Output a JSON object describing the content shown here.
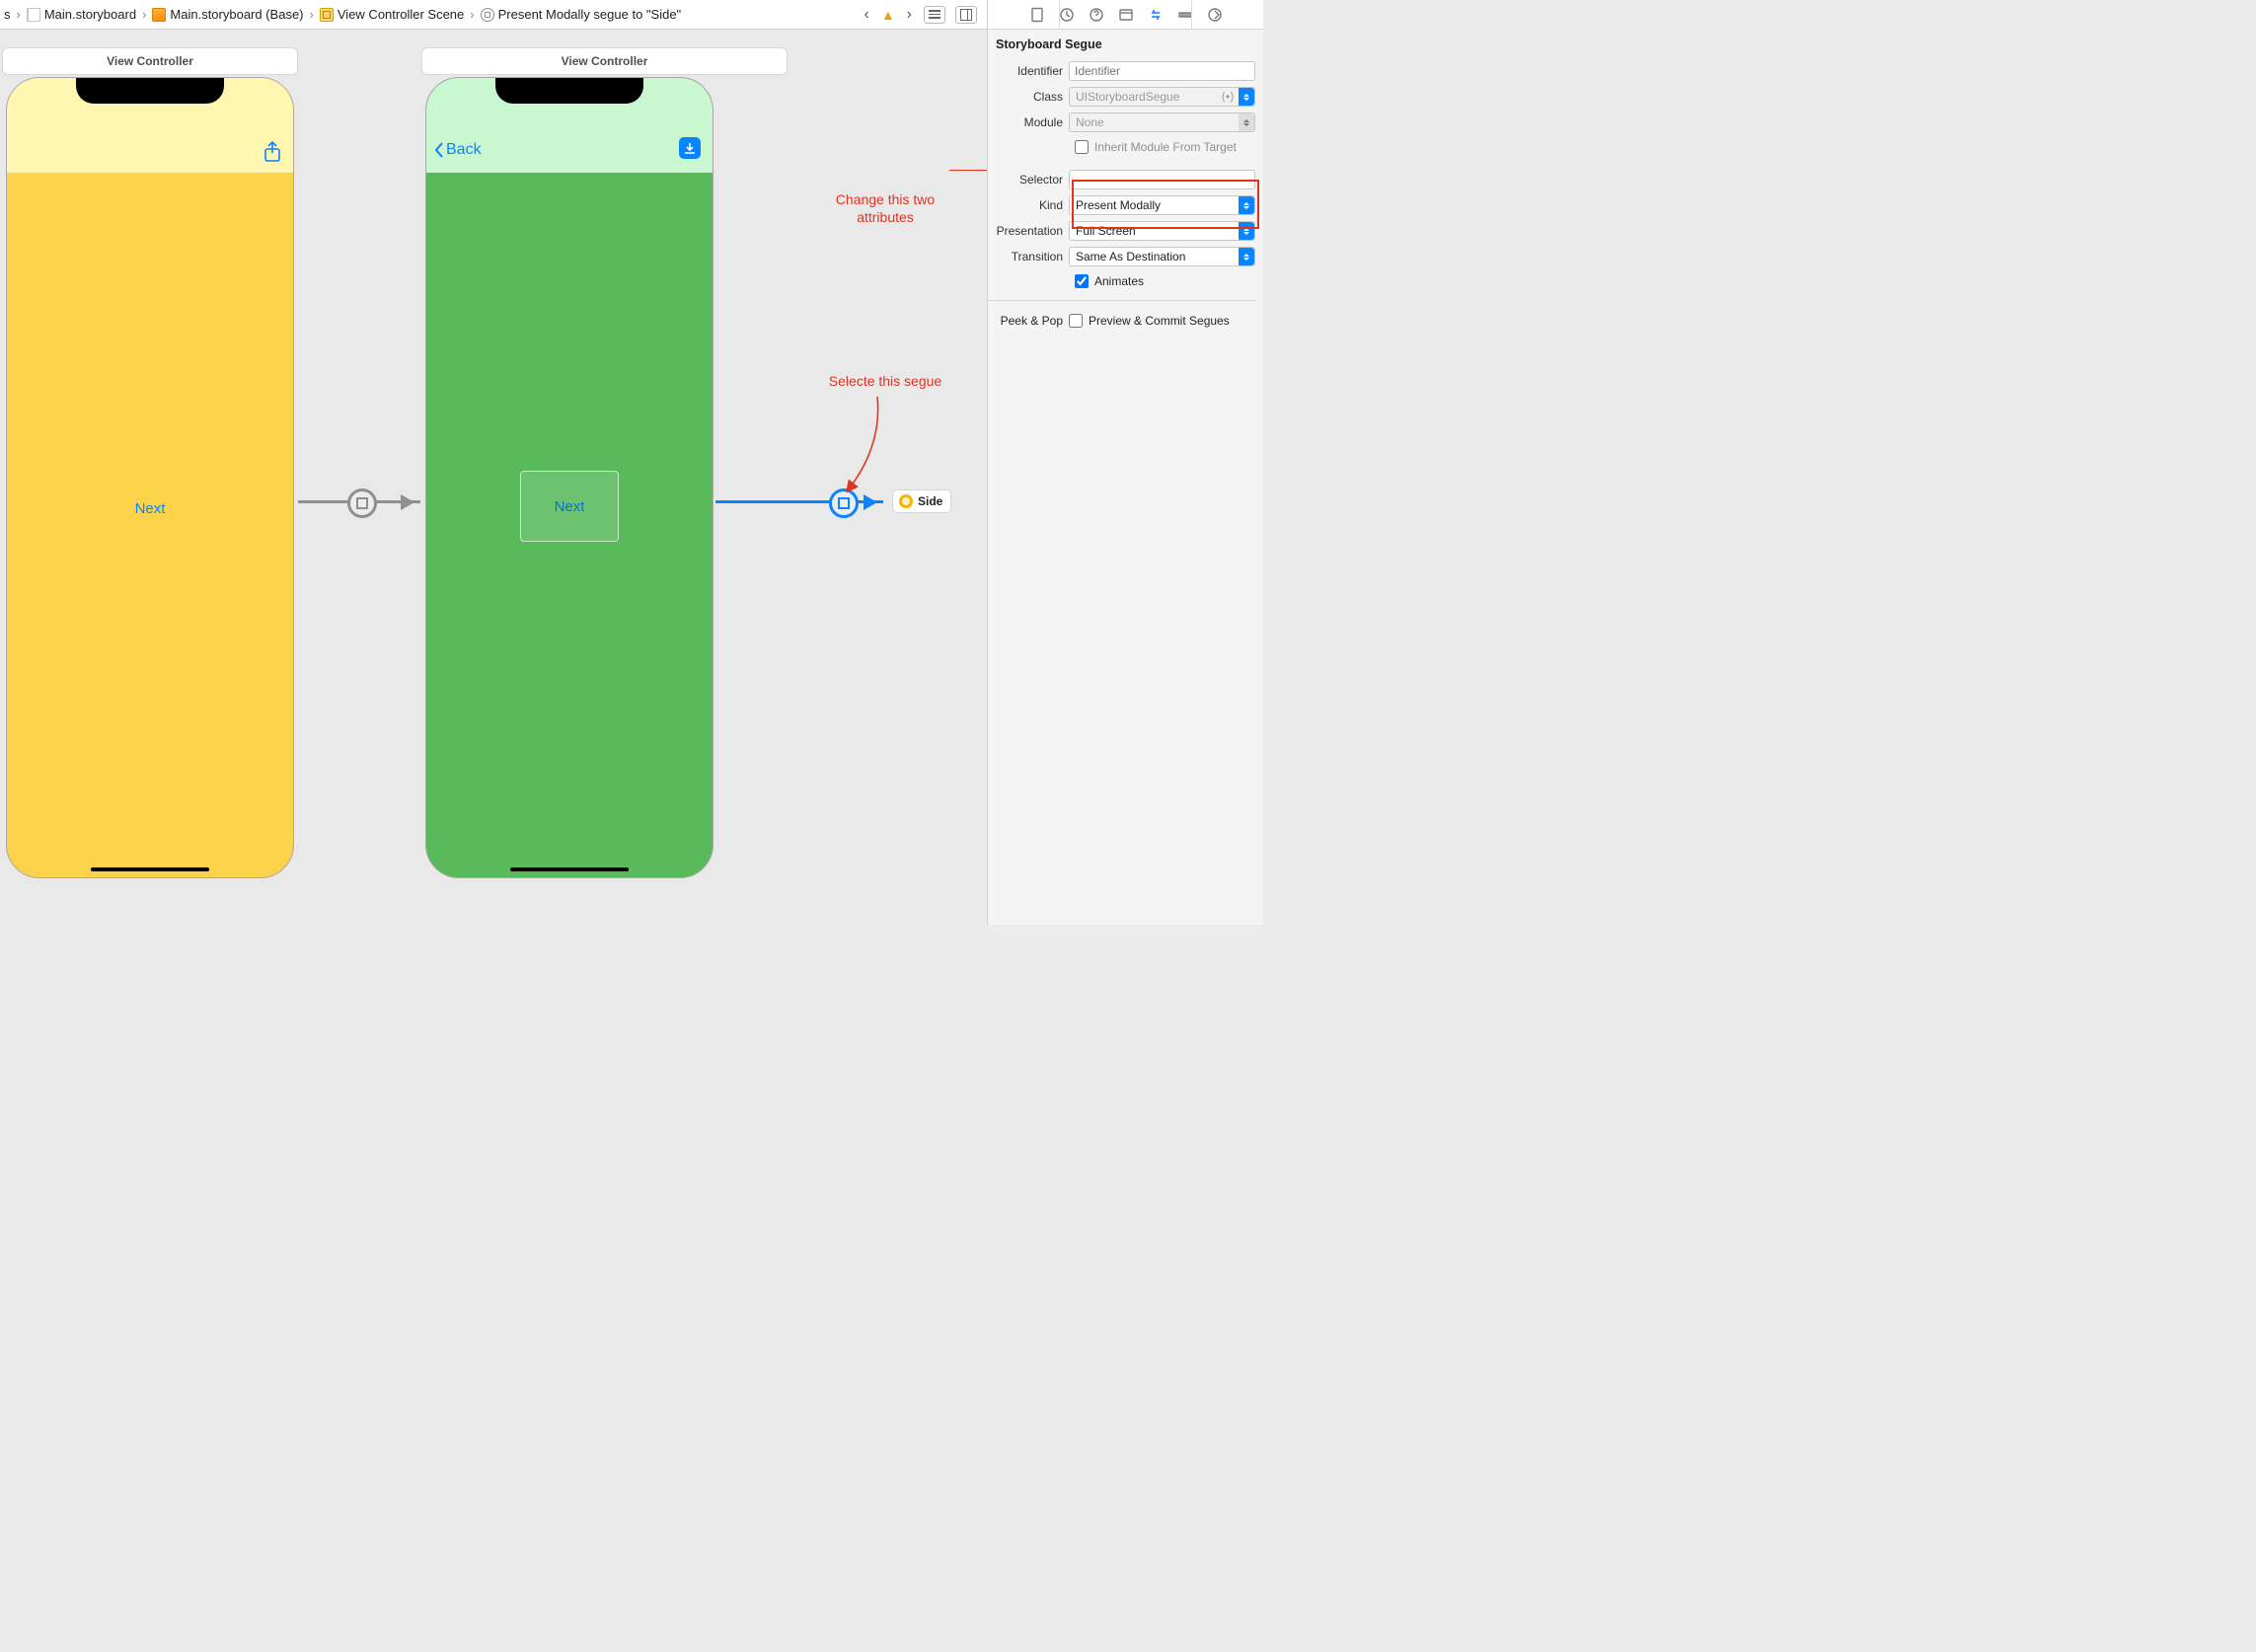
{
  "breadcrumbs": {
    "item0_suffix": "s",
    "item1": "Main.storyboard",
    "item2": "Main.storyboard (Base)",
    "item3": "View Controller Scene",
    "item4": "Present Modally segue to \"Side\""
  },
  "canvas": {
    "scene1_title": "View Controller",
    "scene2_title": "View Controller",
    "p1_next": "Next",
    "p2_back": "Back",
    "p2_next": "Next",
    "dest_label": "Side"
  },
  "annotations": {
    "change_line1": "Change this two",
    "change_line2": "attributes",
    "select_segue": "Selecte this segue"
  },
  "inspector": {
    "section": "Storyboard Segue",
    "labels": {
      "identifier": "Identifier",
      "klass": "Class",
      "module": "Module",
      "inherit": "Inherit Module From Target",
      "selector": "Selector",
      "kind": "Kind",
      "presentation": "Presentation",
      "transition": "Transition",
      "animates": "Animates",
      "peek": "Peek & Pop",
      "peek_opt": "Preview & Commit Segues"
    },
    "values": {
      "identifier_ph": "Identifier",
      "klass": "UIStoryboardSegue",
      "module": "None",
      "selector": "",
      "kind": "Present Modally",
      "presentation": "Full Screen",
      "transition": "Same As Destination"
    },
    "checks": {
      "inherit": false,
      "animates": true,
      "peek": false
    }
  }
}
